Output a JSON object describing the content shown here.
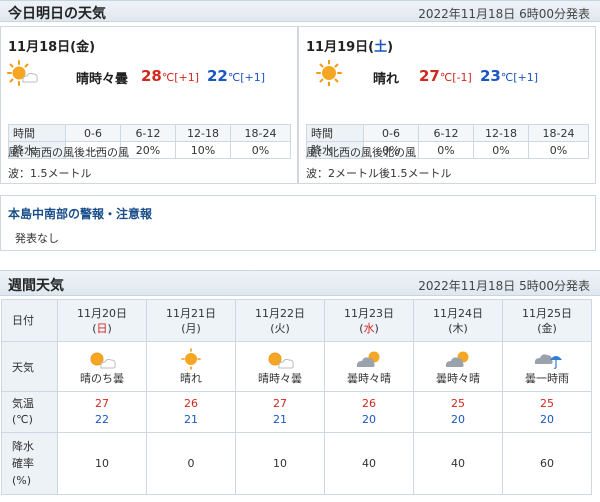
{
  "today_section": {
    "title": "今日明日の天気",
    "issued": "2022年11月18日 6時00分発表",
    "days": [
      {
        "date_prefix": "11月18日(",
        "weekday": "金",
        "date_suffix": ")",
        "weather_icon": "sun-cloud-icon",
        "weather": "晴時々曇",
        "high": "28",
        "high_diff": "℃[+1]",
        "low": "22",
        "low_diff": "℃[+1]",
        "rain_table": {
          "label_time": "時間",
          "label_rain": "降水",
          "periods": [
            "0-6",
            "6-12",
            "12-18",
            "18-24"
          ],
          "values": [
            "---",
            "20%",
            "10%",
            "0%"
          ]
        },
        "wind": "風：南西の風後北西の風",
        "wave": "波：1.5メートル"
      },
      {
        "date_prefix": "11月19日(",
        "weekday": "土",
        "date_suffix": ")",
        "weather_icon": "sun-icon",
        "weather": "晴れ",
        "high": "27",
        "high_diff": "℃[-1]",
        "low": "23",
        "low_diff": "℃[+1]",
        "rain_table": {
          "label_time": "時間",
          "label_rain": "降水",
          "periods": [
            "0-6",
            "6-12",
            "12-18",
            "18-24"
          ],
          "values": [
            "0%",
            "0%",
            "0%",
            "0%"
          ]
        },
        "wind": "風：北西の風後北の風",
        "wave": "波：2メートル後1.5メートル"
      }
    ]
  },
  "warning": {
    "title": "本島中南部の警報・注意報",
    "value": "発表なし"
  },
  "weekly": {
    "title": "週間天気",
    "issued": "2022年11月18日 5時00分発表",
    "row_labels": {
      "date": "日付",
      "weather": "天気",
      "temp_line1": "気温",
      "temp_line2": "(℃)",
      "precip_line1": "降水",
      "precip_line2": "確率",
      "precip_line3": "(%)"
    },
    "days": [
      {
        "date": "11月20日",
        "open": "(",
        "weekday": "日",
        "close": ")",
        "weekday_color": "red",
        "icon": "sun-cloud-icon",
        "weather": "晴のち曇",
        "high": "27",
        "low": "22",
        "precip": "10"
      },
      {
        "date": "11月21日",
        "open": "(",
        "weekday": "月",
        "close": ")",
        "weekday_color": "normal",
        "icon": "sun-icon",
        "weather": "晴れ",
        "high": "26",
        "low": "21",
        "precip": "0"
      },
      {
        "date": "11月22日",
        "open": "(",
        "weekday": "火",
        "close": ")",
        "weekday_color": "normal",
        "icon": "sun-cloud-icon",
        "weather": "晴時々曇",
        "high": "27",
        "low": "21",
        "precip": "10"
      },
      {
        "date": "11月23日",
        "open": "(",
        "weekday": "水",
        "close": ")",
        "weekday_color": "red",
        "icon": "cloud-sun-icon",
        "weather": "曇時々晴",
        "high": "26",
        "low": "20",
        "precip": "40"
      },
      {
        "date": "11月24日",
        "open": "(",
        "weekday": "木",
        "close": ")",
        "weekday_color": "normal",
        "icon": "cloud-sun-icon",
        "weather": "曇時々晴",
        "high": "25",
        "low": "20",
        "precip": "40"
      },
      {
        "date": "11月25日",
        "open": "(",
        "weekday": "金",
        "close": ")",
        "weekday_color": "normal",
        "icon": "cloud-umbrella-icon",
        "weather": "曇一時雨",
        "high": "25",
        "low": "20",
        "precip": "60"
      }
    ]
  },
  "colors": {
    "high": "#d0281f",
    "low": "#1a56c2",
    "header_bg": "#dfe8ef",
    "border": "#cfd8e0",
    "warning_title": "#1a4f8a"
  }
}
